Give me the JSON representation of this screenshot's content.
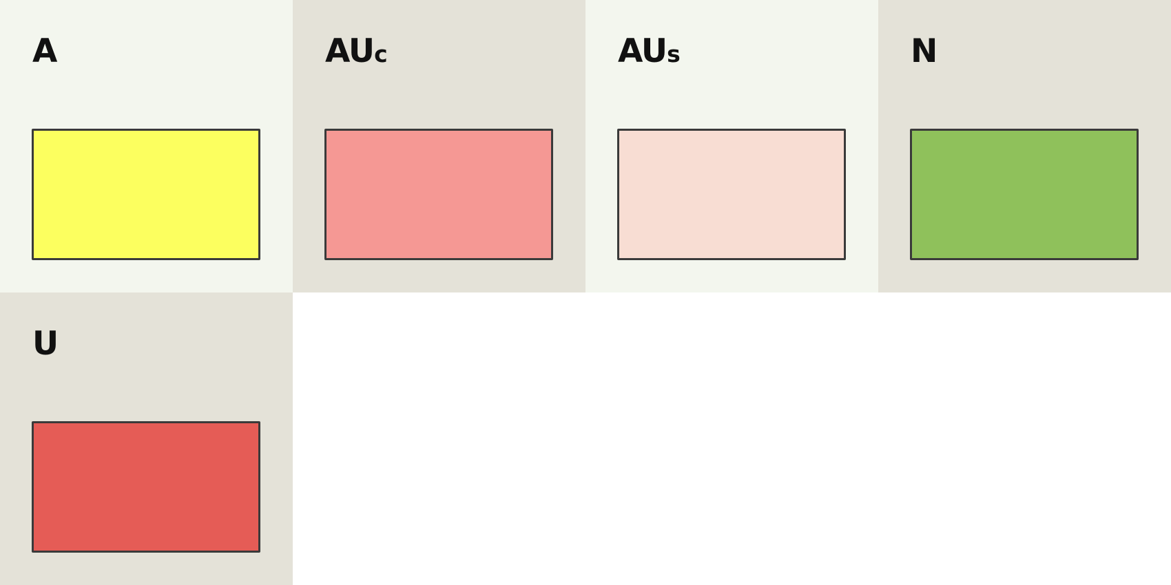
{
  "legend": {
    "items": [
      {
        "label": "A",
        "suffix": "",
        "color": "#fcff5f",
        "tile": "light"
      },
      {
        "label": "AU",
        "suffix": "c",
        "color": "#f59894",
        "tile": "dark"
      },
      {
        "label": "AU",
        "suffix": "s",
        "color": "#f8ddd3",
        "tile": "light"
      },
      {
        "label": "N",
        "suffix": "",
        "color": "#8fc15b",
        "tile": "dark"
      },
      {
        "label": "U",
        "suffix": "",
        "color": "#e55c56",
        "tile": "dark"
      }
    ]
  }
}
